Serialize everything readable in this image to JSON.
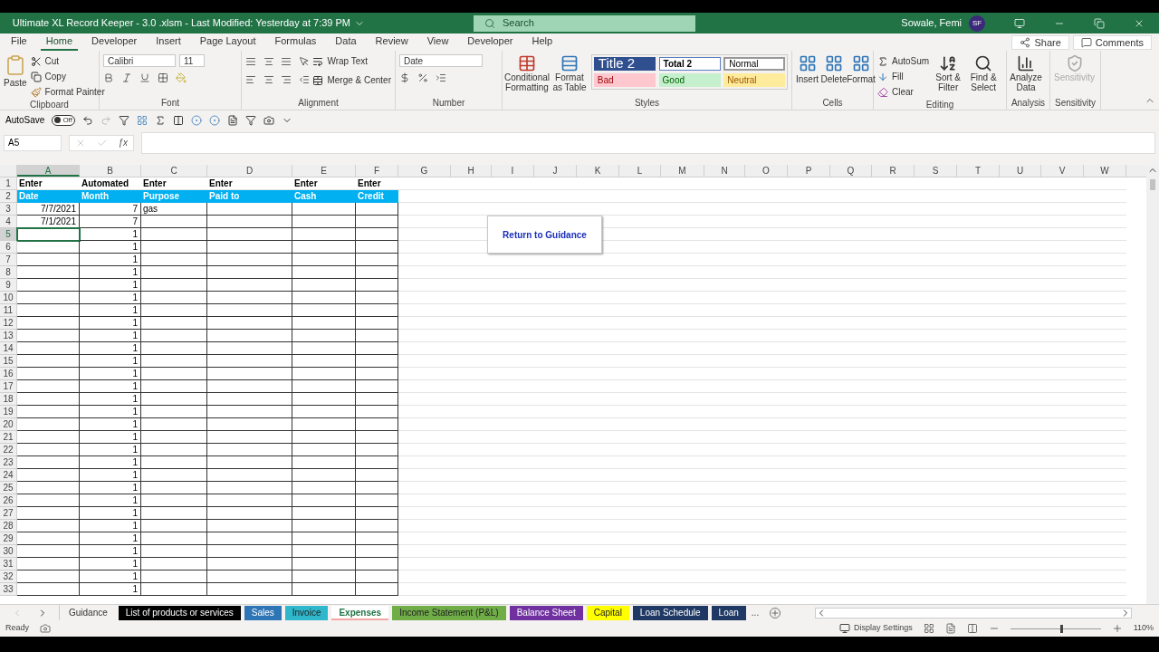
{
  "title_bar": {
    "title": "Ultimate XL Record Keeper - 3.0 .xlsm  -  Last Modified: Yesterday at 7:39 PM",
    "search_placeholder": "Search",
    "user": "Sowale, Femi",
    "initials": "SF"
  },
  "menu_tabs": [
    {
      "label": "File",
      "selected": false
    },
    {
      "label": "Home",
      "selected": true
    },
    {
      "label": "Developer",
      "selected": false
    },
    {
      "label": "Insert",
      "selected": false
    },
    {
      "label": "Page Layout",
      "selected": false
    },
    {
      "label": "Formulas",
      "selected": false
    },
    {
      "label": "Data",
      "selected": false
    },
    {
      "label": "Review",
      "selected": false
    },
    {
      "label": "View",
      "selected": false
    },
    {
      "label": "Developer",
      "selected": false
    },
    {
      "label": "Help",
      "selected": false
    }
  ],
  "share": "Share",
  "comments": "Comments",
  "ribbon": {
    "clipboard": {
      "label": "Clipboard",
      "paste": "Paste",
      "cut": "Cut",
      "copy": "Copy",
      "format_painter": "Format Painter"
    },
    "font": {
      "label": "Font",
      "name": "Calibri",
      "size": "11"
    },
    "alignment": {
      "label": "Alignment",
      "wrap_text": "Wrap Text",
      "merge": "Merge & Center"
    },
    "number": {
      "label": "Number",
      "format": "Date"
    },
    "styles": {
      "label": "Styles",
      "conditional": "Conditional Formatting",
      "format_table": "Format as Table",
      "gallery": [
        {
          "label": "Title 2",
          "kind": "title"
        },
        {
          "label": "Total 2",
          "kind": "total"
        },
        {
          "label": "Normal",
          "kind": "normal"
        },
        {
          "label": "Bad",
          "kind": "bad"
        },
        {
          "label": "Good",
          "kind": "good"
        },
        {
          "label": "Neutral",
          "kind": "neutral"
        }
      ]
    },
    "cells": {
      "label": "Cells",
      "buttons": [
        "Insert",
        "Delete",
        "Format"
      ]
    },
    "editing": {
      "label": "Editing",
      "autosum": "AutoSum",
      "fill": "Fill",
      "clear": "Clear",
      "sort": "Sort & Filter",
      "find": "Find & Select"
    },
    "analysis": {
      "label": "Analysis",
      "button": "Analyze Data"
    },
    "sensitivity": {
      "label": "Sensitivity",
      "button": "Sensitivity",
      "disabled": true
    }
  },
  "quick_access": {
    "autosave": "AutoSave",
    "toggle": {
      "label": "Off",
      "on": false
    }
  },
  "formula_bar": {
    "name_box": "A5",
    "fx": "ƒx"
  },
  "columns": [
    "A",
    "B",
    "C",
    "D",
    "E",
    "F",
    "G",
    "H",
    "I",
    "J",
    "K",
    "L",
    "M",
    "N",
    "O",
    "P",
    "Q",
    "R",
    "S",
    "T",
    "U",
    "V",
    "W"
  ],
  "rows": [
    {
      "num": "1",
      "kind": "label",
      "selected": false,
      "cells": {
        "A": "Enter",
        "B": "Automated",
        "C": "Enter",
        "D": "Enter",
        "E": "Enter",
        "F": "Enter"
      }
    },
    {
      "num": "2",
      "kind": "header",
      "selected": false,
      "cells": {
        "A": "Date",
        "B": "Month",
        "C": "Purpose",
        "D": "Paid to",
        "E": "Cash",
        "F": "Credit"
      }
    },
    {
      "num": "3",
      "kind": "data",
      "selected": false,
      "cells": {
        "A": "7/7/2021",
        "B": "7",
        "C": "gas"
      }
    },
    {
      "num": "4",
      "kind": "data",
      "selected": false,
      "cells": {
        "A": "7/1/2021",
        "B": "7"
      }
    },
    {
      "num": "5",
      "kind": "data",
      "selected": true,
      "cells": {
        "B": "1"
      }
    },
    {
      "num": "6",
      "kind": "data",
      "selected": false,
      "cells": {
        "B": "1"
      }
    },
    {
      "num": "7",
      "kind": "data",
      "selected": false,
      "cells": {
        "B": "1"
      }
    },
    {
      "num": "8",
      "kind": "data",
      "selected": false,
      "cells": {
        "B": "1"
      }
    },
    {
      "num": "9",
      "kind": "data",
      "selected": false,
      "cells": {
        "B": "1"
      }
    },
    {
      "num": "10",
      "kind": "data",
      "selected": false,
      "cells": {
        "B": "1"
      }
    },
    {
      "num": "11",
      "kind": "data",
      "selected": false,
      "cells": {
        "B": "1"
      }
    },
    {
      "num": "12",
      "kind": "data",
      "selected": false,
      "cells": {
        "B": "1"
      }
    },
    {
      "num": "13",
      "kind": "data",
      "selected": false,
      "cells": {
        "B": "1"
      }
    },
    {
      "num": "14",
      "kind": "data",
      "selected": false,
      "cells": {
        "B": "1"
      }
    },
    {
      "num": "15",
      "kind": "data",
      "selected": false,
      "cells": {
        "B": "1"
      }
    },
    {
      "num": "16",
      "kind": "data",
      "selected": false,
      "cells": {
        "B": "1"
      }
    },
    {
      "num": "17",
      "kind": "data",
      "selected": false,
      "cells": {
        "B": "1"
      }
    },
    {
      "num": "18",
      "kind": "data",
      "selected": false,
      "cells": {
        "B": "1"
      }
    },
    {
      "num": "19",
      "kind": "data",
      "selected": false,
      "cells": {
        "B": "1"
      }
    },
    {
      "num": "20",
      "kind": "data",
      "selected": false,
      "cells": {
        "B": "1"
      }
    },
    {
      "num": "21",
      "kind": "data",
      "selected": false,
      "cells": {
        "B": "1"
      }
    },
    {
      "num": "22",
      "kind": "data",
      "selected": false,
      "cells": {
        "B": "1"
      }
    },
    {
      "num": "23",
      "kind": "data",
      "selected": false,
      "cells": {
        "B": "1"
      }
    },
    {
      "num": "24",
      "kind": "data",
      "selected": false,
      "cells": {
        "B": "1"
      }
    },
    {
      "num": "25",
      "kind": "data",
      "selected": false,
      "cells": {
        "B": "1"
      }
    },
    {
      "num": "26",
      "kind": "data",
      "selected": false,
      "cells": {
        "B": "1"
      }
    },
    {
      "num": "27",
      "kind": "data",
      "selected": false,
      "cells": {
        "B": "1"
      }
    },
    {
      "num": "28",
      "kind": "data",
      "selected": false,
      "cells": {
        "B": "1"
      }
    },
    {
      "num": "29",
      "kind": "data",
      "selected": false,
      "cells": {
        "B": "1"
      }
    },
    {
      "num": "30",
      "kind": "data",
      "selected": false,
      "cells": {
        "B": "1"
      }
    },
    {
      "num": "31",
      "kind": "data",
      "selected": false,
      "cells": {
        "B": "1"
      }
    },
    {
      "num": "32",
      "kind": "data",
      "selected": false,
      "cells": {
        "B": "1"
      }
    },
    {
      "num": "33",
      "kind": "data",
      "selected": false,
      "cells": {
        "B": "1"
      }
    }
  ],
  "shape_button": "Return to Guidance",
  "sheet_tabs": [
    {
      "label": "Guidance",
      "selected": false
    },
    {
      "label": "List of products or services",
      "color": "#000000",
      "selected": false
    },
    {
      "label": "Sales",
      "color": "#2e75b6",
      "selected": false
    },
    {
      "label": "Invoice",
      "color": "#2fb8cc",
      "selected": false
    },
    {
      "label": "Expenses",
      "color": "#f4a6a6",
      "selected": true
    },
    {
      "label": "Income Statement (P&L)",
      "color": "#70ad47",
      "selected": false
    },
    {
      "label": "Balance Sheet",
      "color": "#7030a0",
      "selected": false
    },
    {
      "label": "Capital",
      "color": "#ffff00",
      "selected": false
    },
    {
      "label": "Loan Schedule",
      "color": "#1f3864",
      "selected": false
    },
    {
      "label": "Loan",
      "color": "#1f3864",
      "selected": false
    }
  ],
  "more_tabs": "...",
  "status_bar": {
    "ready": "Ready",
    "display_settings": "Display Settings",
    "zoom": "110%",
    "zoom_slider": {
      "level": 0.55
    }
  }
}
